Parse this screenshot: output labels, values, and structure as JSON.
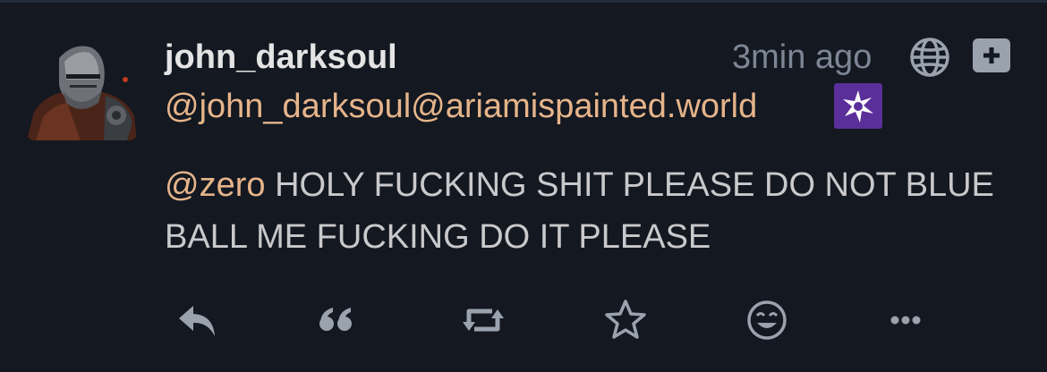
{
  "post": {
    "display_name": "john_darksoul",
    "timestamp": "3min ago",
    "handle": "@john_darksoul@ariamispainted.world",
    "mention": "@zero",
    "body_text": "HOLY FUCKING SHIT PLEASE DO NOT BLUE BALL ME FUCKING DO IT PLEASE"
  },
  "icons": {
    "visibility": "globe-icon",
    "more_menu": "plus-icon",
    "instance": "misskey-instance-icon",
    "reply": "reply-icon",
    "quote": "quote-icon",
    "boost": "repeat-icon",
    "favorite": "star-icon",
    "react": "smiley-icon",
    "more": "ellipsis-icon"
  },
  "colors": {
    "background": "#131821",
    "text": "#c9c9cc",
    "accent": "#e6b48a",
    "muted": "#7d8694",
    "instance_badge": "#5b2f99"
  }
}
